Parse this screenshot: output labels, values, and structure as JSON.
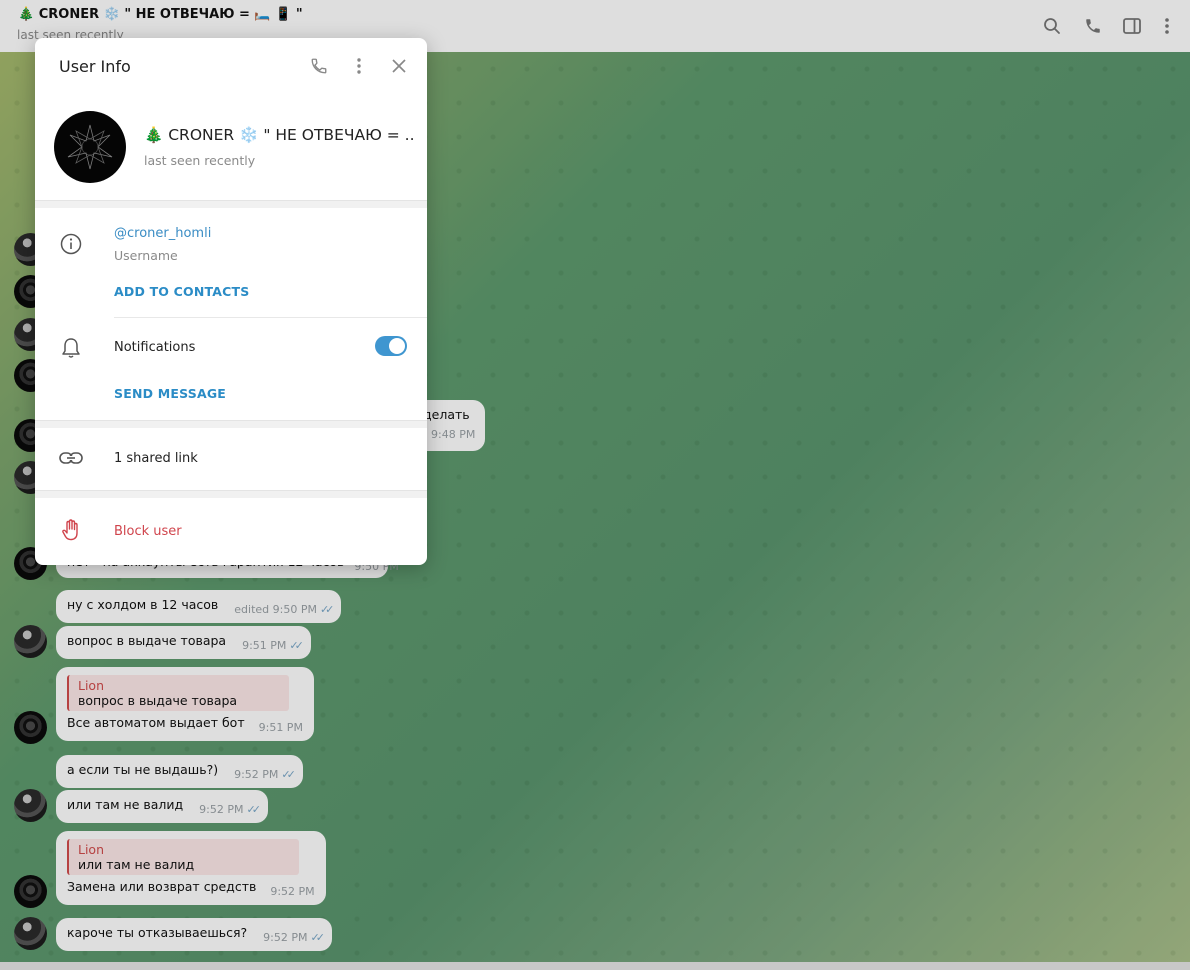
{
  "chat_header": {
    "tree_emoji": "🎄",
    "title_name": "CRONER",
    "snow_emoji": "❄️",
    "title_rest": "\" НЕ ОТВЕЧАЮ =",
    "bed_emoji": "🛏️",
    "phone_emoji": "📱",
    "quote_end": "\"",
    "status": "last seen recently",
    "icons": [
      "search-icon",
      "phone-icon",
      "sidebar-toggle-icon",
      "more-vertical-icon"
    ]
  },
  "modal": {
    "title": "User Info",
    "profile": {
      "name": "🎄 CRONER ❄️ \" НЕ ОТВЕЧАЮ = ...",
      "status": "last seen recently"
    },
    "username": "@croner_homli",
    "username_label": "Username",
    "add_to_contacts": "ADD TO CONTACTS",
    "notifications_label": "Notifications",
    "notifications_on": true,
    "send_message": "SEND MESSAGE",
    "shared_links": "1 shared link",
    "block_user": "Block user"
  },
  "messages": [
    {
      "text": "делать",
      "time": "9:48 PM"
    },
    {
      "text": "нет - на аккаунты есть гарантия 12 часов",
      "time": "9:50 PM"
    },
    {
      "text": "ну с холдом в 12 часов",
      "time": "edited 9:50 PM"
    },
    {
      "text": "вопрос в выдаче товара",
      "time": "9:51 PM"
    },
    {
      "reply_name": "Lion",
      "reply_text": "вопрос в выдаче товара",
      "text": "Все автоматом выдает бот",
      "time": "9:51 PM"
    },
    {
      "text": "а если ты не выдашь?)",
      "time": "9:52 PM"
    },
    {
      "text": "или там не валид",
      "time": "9:52 PM"
    },
    {
      "reply_name": "Lion",
      "reply_text": "или там не валид",
      "text": "Замена или возврат средств",
      "time": "9:52 PM"
    },
    {
      "text": "кароче ты отказываешься?",
      "time": "9:52 PM"
    }
  ],
  "read_checks": "✓✓"
}
